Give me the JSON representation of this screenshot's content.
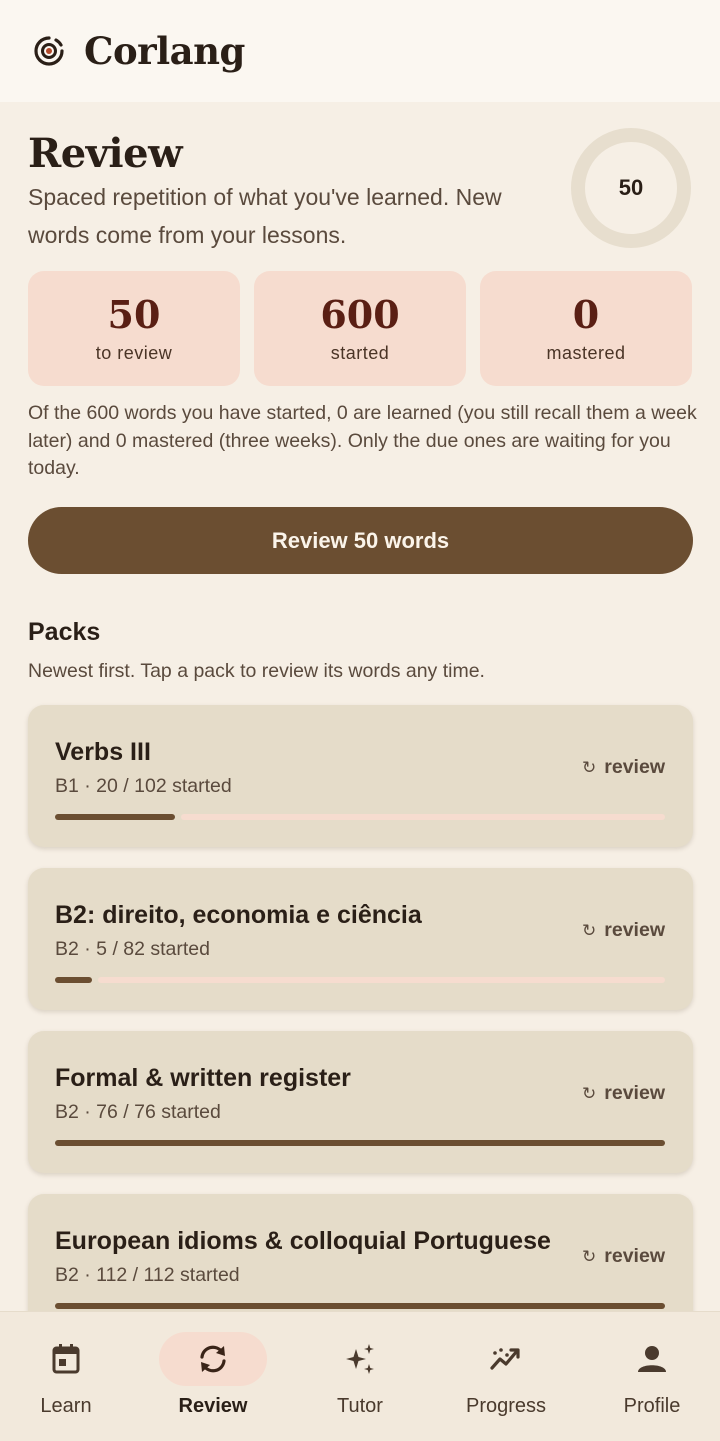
{
  "app": {
    "title": "Corlang"
  },
  "header": {
    "title": "Review",
    "subtitle": "Spaced repetition of what you've learned. New words come from your lessons.",
    "due_count": "50"
  },
  "stats": [
    {
      "value": "50",
      "label": "to review"
    },
    {
      "value": "600",
      "label": "started"
    },
    {
      "value": "0",
      "label": "mastered"
    }
  ],
  "explanation": "Of the 600 words you have started, 0 are learned (you still recall them a week later) and 0 mastered (three weeks). Only the due ones are waiting for you today.",
  "cta": {
    "label": "Review 50 words"
  },
  "packs": {
    "title": "Packs",
    "subtitle": "Newest first. Tap a pack to review its words any time.",
    "items": [
      {
        "name": "Verbs III",
        "meta": "B1 · 20 / 102 started",
        "action": "review",
        "progress": 0.196
      },
      {
        "name": "B2: direito, economia e ciência",
        "meta": "B2 · 5 / 82 started",
        "action": "review",
        "progress": 0.061
      },
      {
        "name": "Formal & written register",
        "meta": "B2 · 76 / 76 started",
        "action": "review",
        "progress": 1.0
      },
      {
        "name": "European idioms & colloquial Portuguese",
        "meta": "B2 · 112 / 112 started",
        "action": "review",
        "progress": 1.0
      }
    ]
  },
  "nav": {
    "items": [
      {
        "label": "Learn",
        "icon": "calendar-icon",
        "active": false
      },
      {
        "label": "Review",
        "icon": "sync-icon",
        "active": true
      },
      {
        "label": "Tutor",
        "icon": "sparkles-icon",
        "active": false
      },
      {
        "label": "Progress",
        "icon": "trend-icon",
        "active": false
      },
      {
        "label": "Profile",
        "icon": "person-icon",
        "active": false
      }
    ]
  },
  "colors": {
    "accent": "#6b4e31",
    "stat_bg": "#f6dccf",
    "card_bg": "#e5dcc9",
    "page_bg": "#f6efe5"
  }
}
